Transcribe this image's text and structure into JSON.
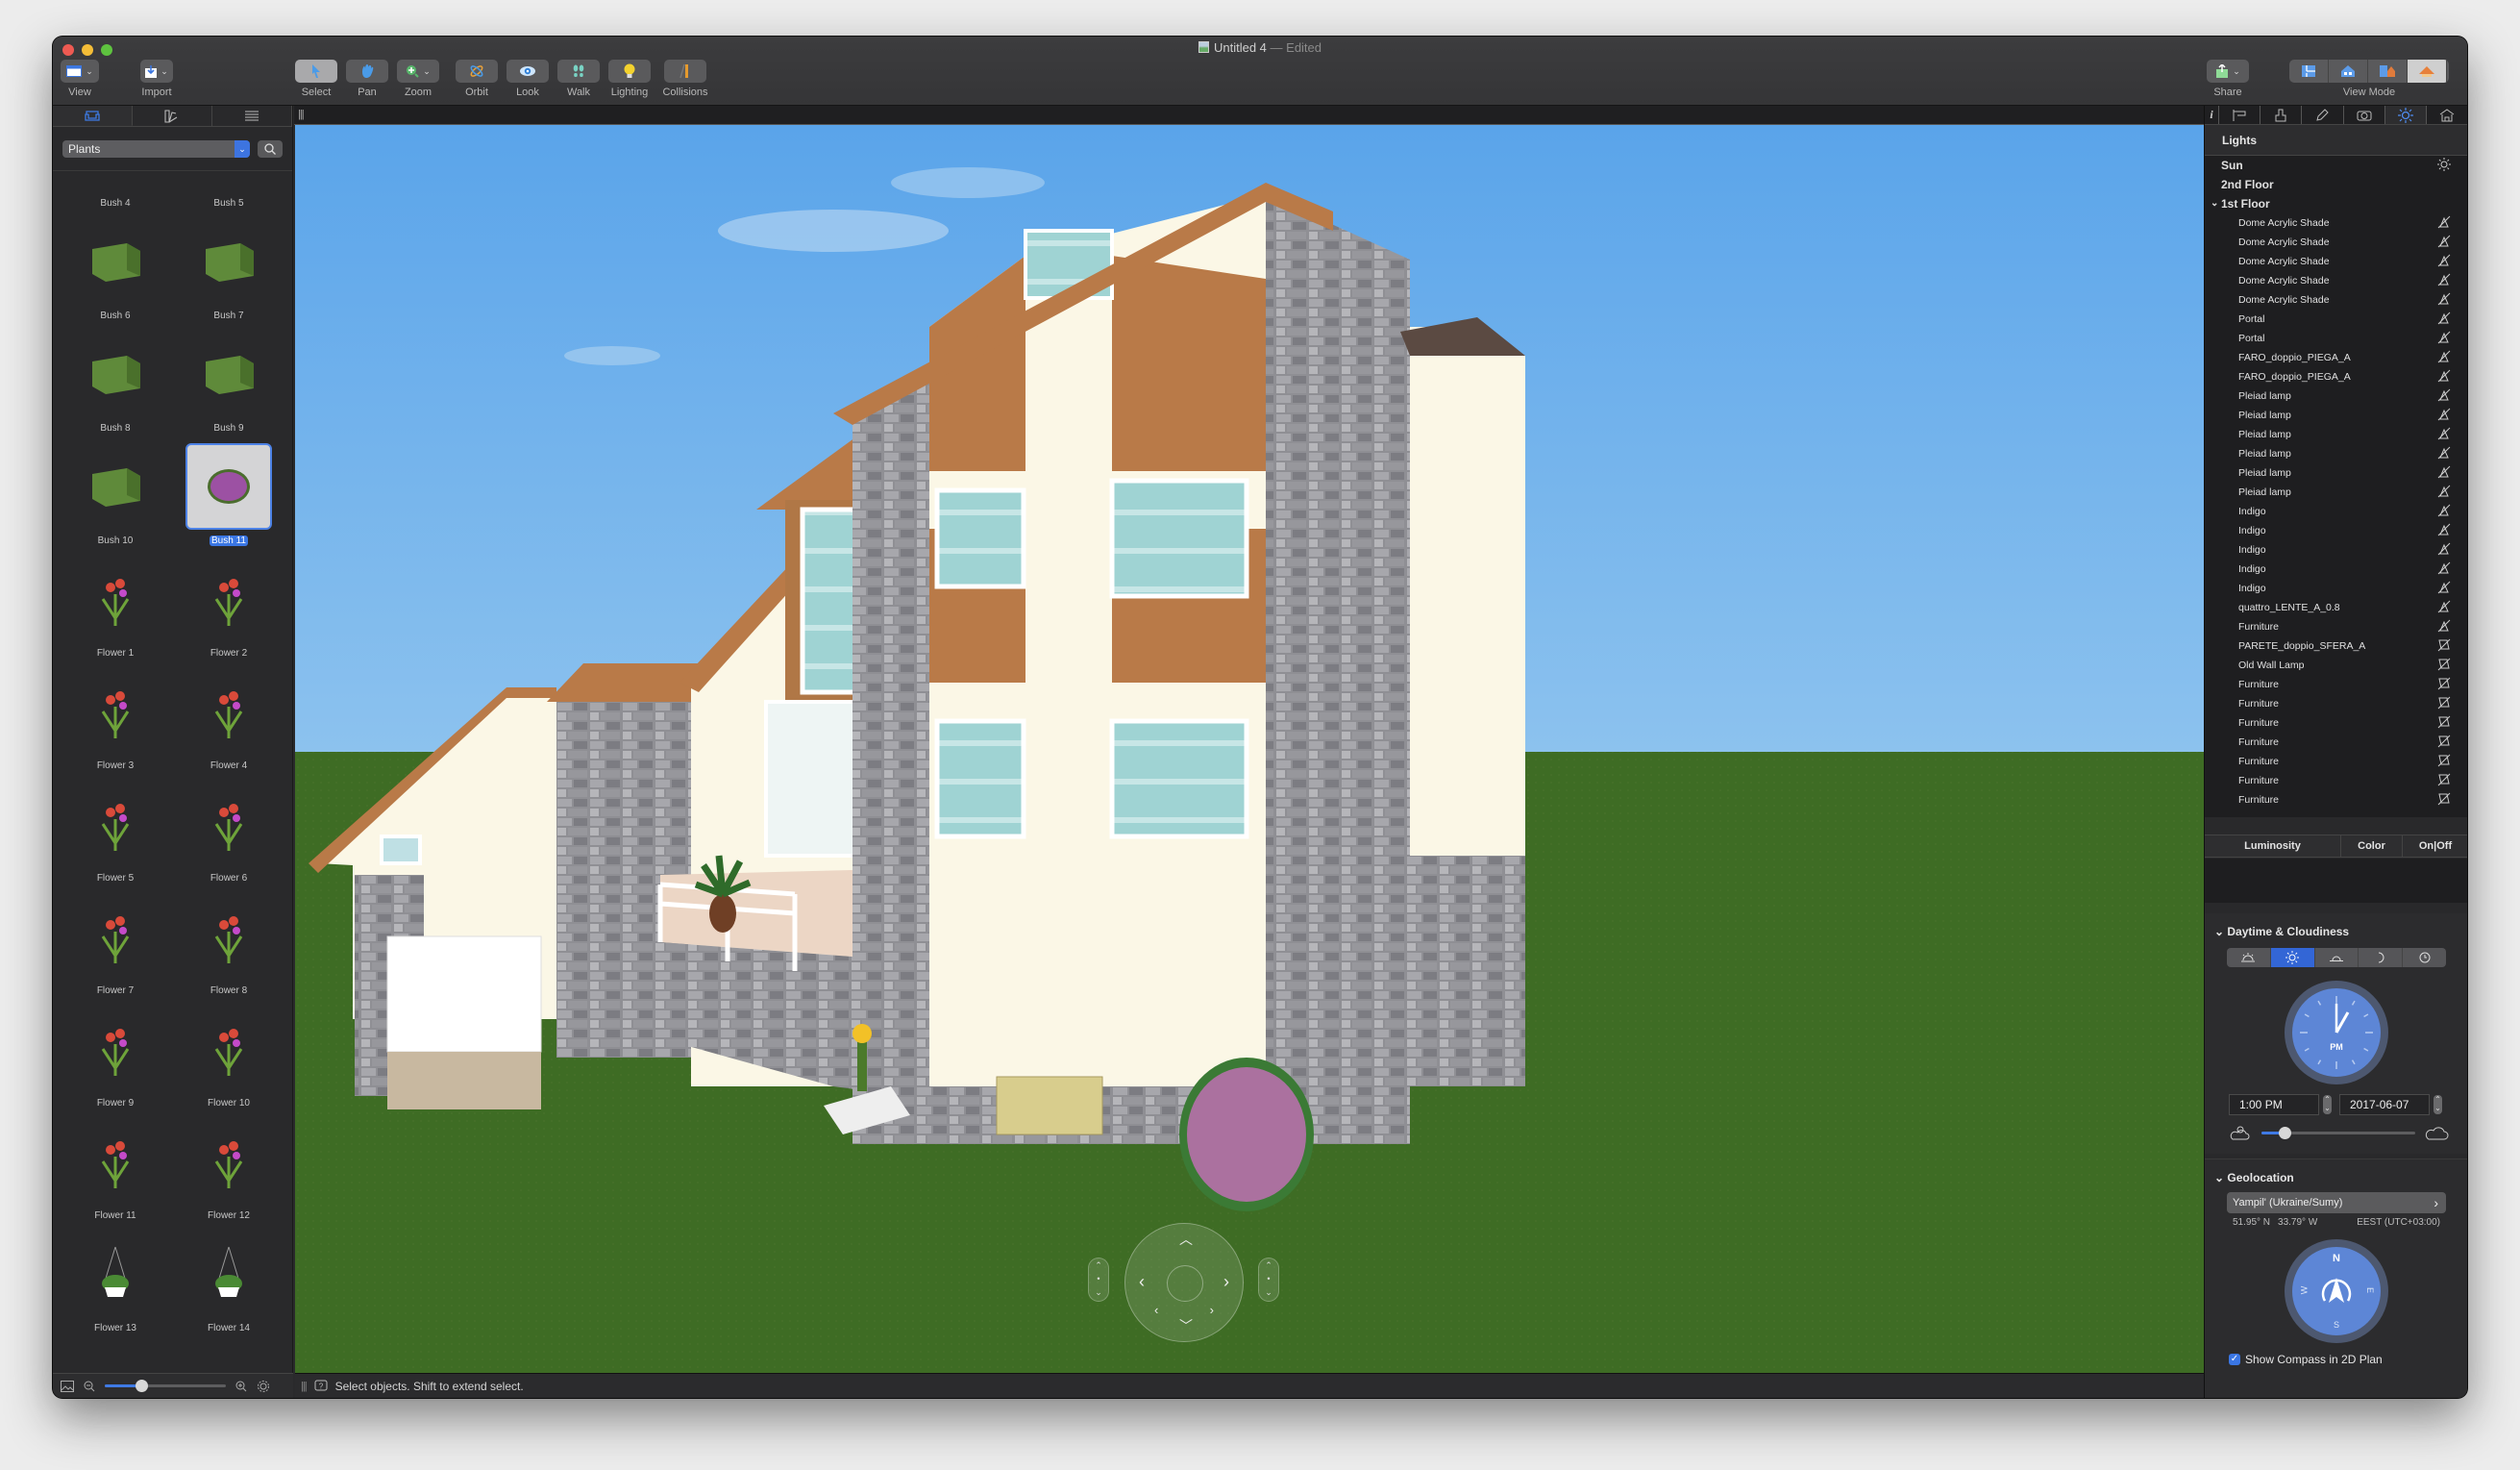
{
  "window": {
    "title": "Untitled 4",
    "title_suffix": "— Edited"
  },
  "toolbar": {
    "view_label": "View",
    "import_label": "Import",
    "tools": [
      {
        "id": "select",
        "label": "Select",
        "icon": "arrow-cursor-icon",
        "active": true
      },
      {
        "id": "pan",
        "label": "Pan",
        "icon": "hand-icon",
        "active": false
      },
      {
        "id": "zoom",
        "label": "Zoom",
        "icon": "zoom-in-icon",
        "active": false
      },
      {
        "id": "orbit",
        "label": "Orbit",
        "icon": "orbit-icon",
        "active": false
      },
      {
        "id": "look",
        "label": "Look",
        "icon": "eye-icon",
        "active": false
      },
      {
        "id": "walk",
        "label": "Walk",
        "icon": "footprints-icon",
        "active": false
      },
      {
        "id": "lighting",
        "label": "Lighting",
        "icon": "lightbulb-icon",
        "active": false
      },
      {
        "id": "collisions",
        "label": "Collisions",
        "icon": "collisions-icon",
        "active": false
      }
    ],
    "share_label": "Share",
    "view_mode_label": "View Mode",
    "view_modes": [
      "2D Plan",
      "2D Elevation",
      "Split",
      "3D"
    ],
    "view_mode_active": "3D"
  },
  "left_sidebar": {
    "tabs": [
      "Library",
      "Materials",
      "List"
    ],
    "active_tab": "Library",
    "category": "Plants",
    "items": [
      {
        "label": "Bush 4"
      },
      {
        "label": "Bush 5"
      },
      {
        "label": "Bush 6"
      },
      {
        "label": "Bush 7"
      },
      {
        "label": "Bush 8"
      },
      {
        "label": "Bush 9"
      },
      {
        "label": "Bush 10"
      },
      {
        "label": "Bush 11",
        "selected": true
      },
      {
        "label": "Flower 1"
      },
      {
        "label": "Flower 2"
      },
      {
        "label": "Flower 3"
      },
      {
        "label": "Flower 4"
      },
      {
        "label": "Flower 5"
      },
      {
        "label": "Flower 6"
      },
      {
        "label": "Flower 7"
      },
      {
        "label": "Flower 8"
      },
      {
        "label": "Flower 9"
      },
      {
        "label": "Flower 10"
      },
      {
        "label": "Flower 11"
      },
      {
        "label": "Flower 12"
      },
      {
        "label": "Flower 13"
      },
      {
        "label": "Flower 14"
      }
    ],
    "thumb_zoom": 0.3
  },
  "status_bar": {
    "message": "Select objects. Shift to extend select."
  },
  "right_sidebar": {
    "tabs": [
      "Info",
      "Dimensions",
      "Style",
      "Edit",
      "Camera",
      "Lights",
      "Building"
    ],
    "active_tab": "Lights",
    "lights_panel": {
      "title": "Lights",
      "rows": [
        {
          "label": "Sun",
          "type": "group",
          "icon": "sun-icon"
        },
        {
          "label": "2nd Floor",
          "type": "group"
        },
        {
          "label": "1st Floor",
          "type": "group",
          "expanded": true
        },
        {
          "label": "Dome Acrylic Shade",
          "type": "child",
          "icon": "lamp-off-icon"
        },
        {
          "label": "Dome Acrylic Shade",
          "type": "child",
          "icon": "lamp-off-icon"
        },
        {
          "label": "Dome Acrylic Shade",
          "type": "child",
          "icon": "lamp-off-icon"
        },
        {
          "label": "Dome Acrylic Shade",
          "type": "child",
          "icon": "lamp-off-icon"
        },
        {
          "label": "Dome Acrylic Shade",
          "type": "child",
          "icon": "lamp-off-icon"
        },
        {
          "label": "Portal",
          "type": "child",
          "icon": "lamp-off-icon"
        },
        {
          "label": "Portal",
          "type": "child",
          "icon": "lamp-off-icon"
        },
        {
          "label": "FARO_doppio_PIEGA_A",
          "type": "child",
          "icon": "lamp-off-icon"
        },
        {
          "label": "FARO_doppio_PIEGA_A",
          "type": "child",
          "icon": "lamp-off-icon"
        },
        {
          "label": "Pleiad lamp",
          "type": "child",
          "icon": "lamp-off-icon"
        },
        {
          "label": "Pleiad lamp",
          "type": "child",
          "icon": "lamp-off-icon"
        },
        {
          "label": "Pleiad lamp",
          "type": "child",
          "icon": "lamp-off-icon"
        },
        {
          "label": "Pleiad lamp",
          "type": "child",
          "icon": "lamp-off-icon"
        },
        {
          "label": "Pleiad lamp",
          "type": "child",
          "icon": "lamp-off-icon"
        },
        {
          "label": "Pleiad lamp",
          "type": "child",
          "icon": "lamp-off-icon"
        },
        {
          "label": "Indigo",
          "type": "child",
          "icon": "lamp-off-icon"
        },
        {
          "label": "Indigo",
          "type": "child",
          "icon": "lamp-off-icon"
        },
        {
          "label": "Indigo",
          "type": "child",
          "icon": "lamp-off-icon"
        },
        {
          "label": "Indigo",
          "type": "child",
          "icon": "lamp-off-icon"
        },
        {
          "label": "Indigo",
          "type": "child",
          "icon": "lamp-off-icon"
        },
        {
          "label": "quattro_LENTE_A_0.8",
          "type": "child",
          "icon": "lamp-off-icon"
        },
        {
          "label": "Furniture",
          "type": "child",
          "icon": "lamp-off-icon"
        },
        {
          "label": "PARETE_doppio_SFERA_A",
          "type": "child",
          "icon": "spotlight-off-icon"
        },
        {
          "label": "Old Wall Lamp",
          "type": "child",
          "icon": "spotlight-off-icon"
        },
        {
          "label": "Furniture",
          "type": "child",
          "icon": "spotlight-off-icon"
        },
        {
          "label": "Furniture",
          "type": "child",
          "icon": "spotlight-off-icon"
        },
        {
          "label": "Furniture",
          "type": "child",
          "icon": "spotlight-off-icon"
        },
        {
          "label": "Furniture",
          "type": "child",
          "icon": "spotlight-off-icon"
        },
        {
          "label": "Furniture",
          "type": "child",
          "icon": "spotlight-off-icon"
        },
        {
          "label": "Furniture",
          "type": "child",
          "icon": "spotlight-off-icon"
        },
        {
          "label": "Furniture",
          "type": "child",
          "icon": "spotlight-off-icon"
        }
      ],
      "columns": [
        "Luminosity",
        "Color",
        "On|Off"
      ]
    },
    "daytime": {
      "title": "Daytime & Cloudiness",
      "presets": [
        "Sunrise",
        "Noon",
        "Sunset",
        "Night",
        "Custom"
      ],
      "active_preset": "Noon",
      "clock_period": "PM",
      "time": "1:00 PM",
      "date": "2017-06-07",
      "cloudiness": 0.15
    },
    "geolocation": {
      "title": "Geolocation",
      "city": "Yampil' (Ukraine/Sumy)",
      "latitude": "51.95° N",
      "longitude": "33.79° W",
      "timezone": "EEST (UTC+03:00)",
      "compass": {
        "n": "N",
        "e": "E",
        "s": "S",
        "w": "W"
      },
      "show_compass_label": "Show Compass in 2D Plan",
      "show_compass": true
    }
  },
  "colors": {
    "accent": "#3a76e4",
    "sky": "#6aacea",
    "grass": "#3d6b22",
    "roof_trim": "#b97a48",
    "wall_cream": "#fbf7e6"
  }
}
